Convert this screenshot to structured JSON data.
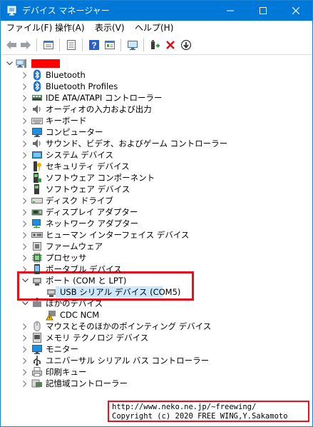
{
  "window": {
    "title": "デバイス マネージャー",
    "controls": {
      "minimize": "minimize-icon",
      "maximize": "maximize-icon",
      "close": "close-icon"
    }
  },
  "menubar": {
    "items": [
      "ファイル(F)",
      "操作(A)",
      "表示(V)",
      "ヘルプ(H)"
    ]
  },
  "toolbar": {
    "buttons": [
      "back-icon",
      "forward-icon",
      "properties-icon",
      "driver-icon",
      "help-icon",
      "view-icon",
      "scan-hardware-icon",
      "add-driver-icon",
      "uninstall-icon",
      "update-driver-icon"
    ]
  },
  "tree": {
    "root": {
      "label": "",
      "icon": "computer-icon",
      "redacted_color": "#ff0000"
    },
    "categories": [
      {
        "label": "Bluetooth",
        "icon": "bluetooth-icon",
        "expanded": false
      },
      {
        "label": "Bluetooth Profiles",
        "icon": "bluetooth-icon",
        "expanded": false
      },
      {
        "label": "IDE ATA/ATAPI コントローラー",
        "icon": "ide-controller-icon",
        "expanded": false
      },
      {
        "label": "オーディオの入力および出力",
        "icon": "speaker-icon",
        "expanded": false
      },
      {
        "label": "キーボード",
        "icon": "keyboard-icon",
        "expanded": false
      },
      {
        "label": "コンピューター",
        "icon": "monitor-icon",
        "expanded": false
      },
      {
        "label": "サウンド、ビデオ、およびゲーム コントローラー",
        "icon": "speaker-icon",
        "expanded": false
      },
      {
        "label": "システム デバイス",
        "icon": "system-device-icon",
        "expanded": false
      },
      {
        "label": "セキュリティ デバイス",
        "icon": "security-key-icon",
        "expanded": false
      },
      {
        "label": "ソフトウェア コンポーネント",
        "icon": "software-component-icon",
        "expanded": false
      },
      {
        "label": "ソフトウェア デバイス",
        "icon": "software-device-icon",
        "expanded": false
      },
      {
        "label": "ディスク ドライブ",
        "icon": "disk-drive-icon",
        "expanded": false
      },
      {
        "label": "ディスプレイ アダプター",
        "icon": "display-adapter-icon",
        "expanded": false
      },
      {
        "label": "ネットワーク アダプター",
        "icon": "network-adapter-icon",
        "expanded": false
      },
      {
        "label": "ヒューマン インターフェイス デバイス",
        "icon": "hid-icon",
        "expanded": false
      },
      {
        "label": "ファームウェア",
        "icon": "firmware-icon",
        "expanded": false
      },
      {
        "label": "プロセッサ",
        "icon": "processor-icon",
        "expanded": false
      },
      {
        "label": "ポータブル デバイス",
        "icon": "portable-device-icon",
        "expanded": false
      },
      {
        "label": "ポート (COM と LPT)",
        "icon": "port-icon",
        "expanded": true,
        "children": [
          {
            "label": "USB シリアル デバイス (COM5)",
            "icon": "port-icon",
            "selected": true
          }
        ]
      },
      {
        "label": "ほかのデバイス",
        "icon": "unknown-device-icon",
        "expanded": true,
        "children": [
          {
            "label": "CDC NCM",
            "icon": "warning-device-icon"
          }
        ]
      },
      {
        "label": "マウスとそのほかのポインティング デバイス",
        "icon": "mouse-icon",
        "expanded": false
      },
      {
        "label": "メモリ テクノロジ デバイス",
        "icon": "memory-device-icon",
        "expanded": false
      },
      {
        "label": "モニター",
        "icon": "monitor-icon",
        "expanded": false
      },
      {
        "label": "ユニバーサル シリアル バス コントローラー",
        "icon": "usb-icon",
        "expanded": false
      },
      {
        "label": "印刷キュー",
        "icon": "printer-icon",
        "expanded": false
      },
      {
        "label": "記憶域コントローラー",
        "icon": "storage-controller-icon",
        "expanded": false
      }
    ]
  },
  "stamp": {
    "line1": "http://www.neko.ne.jp/~freewing/",
    "line2": "Copyright (c) 2020 FREE WING,Y.Sakamoto"
  }
}
